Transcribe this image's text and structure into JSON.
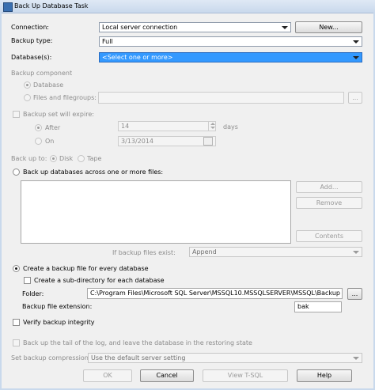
{
  "window": {
    "title": "Back Up Database Task"
  },
  "connection": {
    "label": "Connection:",
    "value": "Local server connection",
    "new_button": "New..."
  },
  "backup_type": {
    "label": "Backup type:",
    "value": "Full"
  },
  "databases": {
    "label": "Database(s):",
    "value": "<Select one or more>"
  },
  "backup_component": {
    "label": "Backup component",
    "database": "Database",
    "files": "Files and filegroups:",
    "browse": "..."
  },
  "expire": {
    "label": "Backup set will expire:",
    "after": "After",
    "after_value": "14",
    "days": "days",
    "on": "On",
    "on_value": "3/13/2014"
  },
  "backup_to": {
    "label": "Back up to:",
    "disk": "Disk",
    "tape": "Tape"
  },
  "across_files": {
    "label": "Back up databases across one or more files:",
    "add": "Add...",
    "remove": "Remove",
    "contents": "Contents",
    "if_exist_label": "If backup files exist:",
    "if_exist_value": "Append"
  },
  "per_db": {
    "label": "Create a backup file for every database",
    "subdir": "Create a sub-directory for each database",
    "folder_label": "Folder:",
    "folder_value": "C:\\Program Files\\Microsoft SQL Server\\MSSQL10.MSSQLSERVER\\MSSQL\\Backup",
    "browse": "...",
    "ext_label": "Backup file extension:",
    "ext_value": "bak"
  },
  "verify": {
    "label": "Verify backup integrity"
  },
  "tail_log": {
    "label": "Back up the tail of the log, and leave the database in the restoring state"
  },
  "compression": {
    "label": "Set backup compression:",
    "value": "Use the default server setting"
  },
  "footer": {
    "ok": "OK",
    "cancel": "Cancel",
    "view_tsql": "View T-SQL",
    "help": "Help"
  }
}
